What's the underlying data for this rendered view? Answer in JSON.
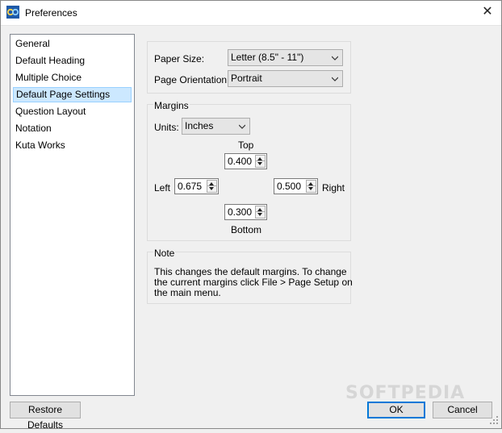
{
  "window": {
    "title": "Preferences",
    "close_glyph": "✕"
  },
  "sidebar": {
    "items": [
      {
        "label": "General"
      },
      {
        "label": "Default Heading"
      },
      {
        "label": "Multiple Choice"
      },
      {
        "label": "Default Page Settings",
        "selected": true
      },
      {
        "label": "Question Layout"
      },
      {
        "label": "Notation"
      },
      {
        "label": "Kuta Works"
      }
    ]
  },
  "page": {
    "paper_size_label": "Paper Size:",
    "paper_size_value": "Letter (8.5\" - 11\")",
    "orientation_label": "Page Orientation:",
    "orientation_value": "Portrait"
  },
  "margins": {
    "group_label": "Margins",
    "units_label": "Units:",
    "units_value": "Inches",
    "top_label": "Top",
    "top_value": "0.400",
    "left_label": "Left",
    "left_value": "0.675",
    "right_label": "Right",
    "right_value": "0.500",
    "bottom_label": "Bottom",
    "bottom_value": "0.300"
  },
  "note": {
    "group_label": "Note",
    "lines": [
      "This changes the default margins.  To change",
      "the current margins click File > Page Setup on",
      "the main menu."
    ]
  },
  "buttons": {
    "restore": "Restore Defaults",
    "ok": "OK",
    "cancel": "Cancel"
  },
  "watermark": "SOFTPEDIA",
  "colors": {
    "selection_bg": "#cce8ff",
    "default_button_border": "#0078d7"
  }
}
